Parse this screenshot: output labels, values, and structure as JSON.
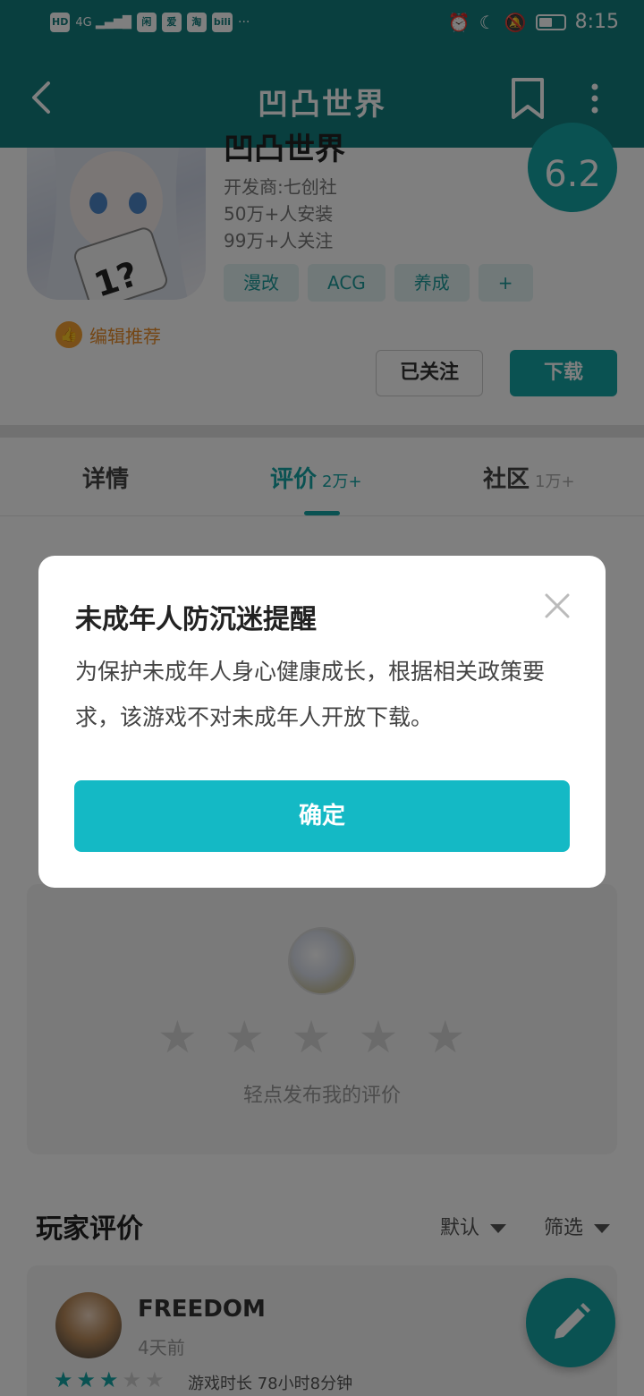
{
  "status_bar": {
    "network": "HD",
    "signal": "4G",
    "app_icons": [
      "闲",
      "爱",
      "淘",
      "bili"
    ],
    "more": "···",
    "time": "8:15"
  },
  "app_bar": {
    "title": "凹凸世界"
  },
  "game": {
    "name": "凹凸世界",
    "developer": "开发商:七创社",
    "installs": "50万+人安装",
    "followers": "99万+人关注",
    "tags": [
      "漫改",
      "ACG",
      "养成",
      "+"
    ],
    "rating": "6.2",
    "editor_pick": "编辑推荐",
    "follow_label": "已关注",
    "download_label": "下载"
  },
  "tabs": [
    {
      "label": "详情",
      "count": ""
    },
    {
      "label": "评价",
      "count": "2万+"
    },
    {
      "label": "社区",
      "count": "1万+"
    }
  ],
  "write_review": {
    "hint": "轻点发布我的评价",
    "star_count": 5
  },
  "player_reviews": {
    "title": "玩家评价",
    "sort_label": "默认",
    "filter_label": "筛选",
    "items": [
      {
        "user": "FREEDOM",
        "time": "4天前",
        "stars": 3,
        "max_stars": 5,
        "playtime": "游戏时长 78小时8分钟"
      }
    ]
  },
  "modal": {
    "title": "未成年人防沉迷提醒",
    "body": "为保护未成年人身心健康成长，根据相关政策要求，该游戏不对未成年人开放下载。",
    "confirm_label": "确定"
  },
  "colors": {
    "primary": "#137e7e",
    "accent": "#14a5a5",
    "confirm": "#14b9c5",
    "editor": "#e98d2a"
  }
}
